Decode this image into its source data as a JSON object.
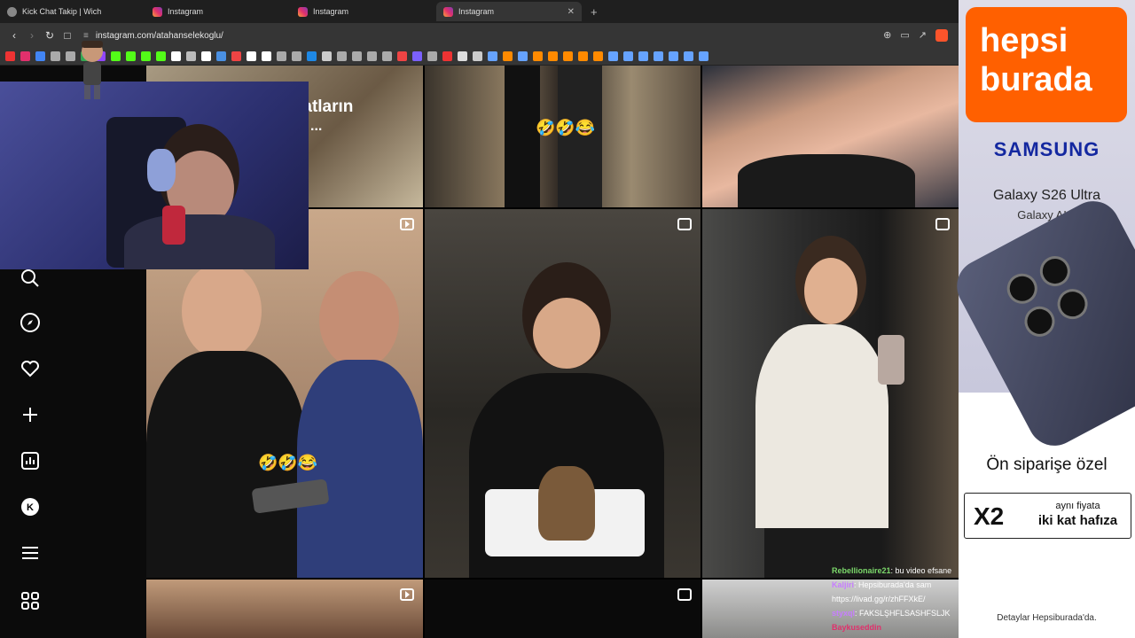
{
  "browser": {
    "tabs": [
      {
        "title": "Kick Chat Takip | Wich",
        "icon": "globe-icon",
        "active": false
      },
      {
        "title": "Instagram",
        "icon": "instagram-icon",
        "active": false
      },
      {
        "title": "Instagram",
        "icon": "instagram-icon",
        "active": false
      },
      {
        "title": "Instagram",
        "icon": "instagram-icon",
        "active": true
      }
    ],
    "new_tab": "+",
    "close": "✕",
    "url": "instagram.com/atahanselekoglu/",
    "bookmark_colors": [
      "#e33",
      "#e1306c",
      "#4285f4",
      "#aaa",
      "#aaa",
      "#34a853",
      "#9146ff",
      "#53fc18",
      "#53fc18",
      "#53fc18",
      "#53fc18",
      "#fff",
      "#bbb",
      "#fff",
      "#4a90e2",
      "#e44",
      "#fff",
      "#fff",
      "#aaa",
      "#aaa",
      "#1e88e5",
      "#ccc",
      "#aaa",
      "#aaa",
      "#aaa",
      "#aaa",
      "#e44",
      "#7b61ff",
      "#aaa",
      "#e33",
      "#ddd",
      "#ccc",
      "#66a3ff",
      "#ff8a00",
      "#66a3ff",
      "#ff8a00",
      "#ff8a00",
      "#ff8a00",
      "#ff8a00",
      "#ff8a00",
      "#66a3ff",
      "#66a3ff",
      "#66a3ff",
      "#66a3ff",
      "#66a3ff",
      "#66a3ff",
      "#66a3ff"
    ]
  },
  "grid": {
    "overlay_caption": "z hatların",
    "overlay_ellipsis": "...",
    "emoji_row1": "🤣🤣😂",
    "emoji_row2": "🤣🤣😂"
  },
  "chat": [
    {
      "user": "Rebellionaire21",
      "user_color": "#7cd96b",
      "text": ": bu video efsane"
    },
    {
      "user": "Kaljiri",
      "user_color": "#c77dff",
      "text": ": Hepsiburada'da sam"
    },
    {
      "user": "",
      "user_color": "#fff",
      "text": "https://livad.gg/r/zhFFXkE/"
    },
    {
      "user": "styxql",
      "user_color": "#c77dff",
      "text": ": FAKSLŞHFLSASHFSLJK"
    },
    {
      "user": "Baykuseddin",
      "user_color": "#e0306c",
      "text": ""
    }
  ],
  "ad": {
    "brand": "hepsi burada",
    "brand_line1": "hepsi",
    "brand_line2": "burada",
    "samsung": "SAMSUNG",
    "model": "Galaxy S26 Ultra",
    "ai": "Galaxy AI✦",
    "promo": "Ön siparişe özel",
    "x2": "X2",
    "same_price": "aynı fiyata",
    "double_storage": "iki kat hafıza",
    "details": "Detaylar Hepsiburada'da.",
    "brand_color": "#ff6000",
    "samsung_color": "#1428a0"
  }
}
